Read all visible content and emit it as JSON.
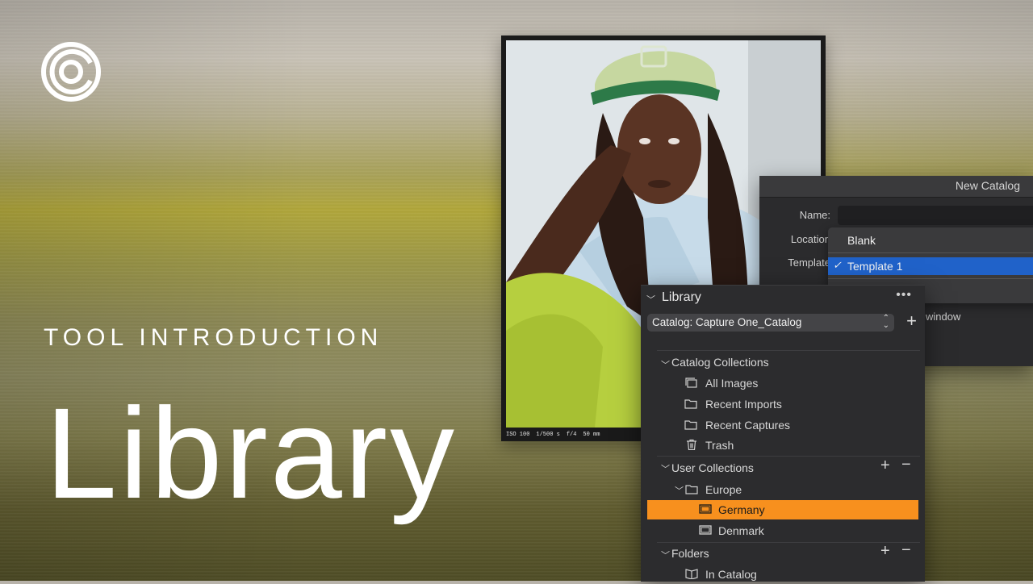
{
  "branding": {
    "tool_intro": "TOOL INTRODUCTION",
    "big_title": "Library",
    "logo_icon": "capture-one-logo-icon"
  },
  "photo": {
    "caption": {
      "iso": "ISO 100",
      "shutter": "1/500 s",
      "aperture": "f/4",
      "focal": "50 mm"
    }
  },
  "new_catalog_dialog": {
    "title": "New Catalog",
    "name_label": "Name:",
    "location_label": "Location",
    "template_label": "Template",
    "window_text": "window",
    "template_options": [
      {
        "label": "Blank",
        "selected": false
      },
      {
        "label": "Template 1",
        "selected": true
      }
    ]
  },
  "library_panel": {
    "title": "Library",
    "more_label": "•••",
    "catalog_selector": "Catalog: Capture One_Catalog",
    "catalog_collections": {
      "title": "Catalog Collections",
      "items": [
        {
          "label": "All Images",
          "icon": "all-images-icon"
        },
        {
          "label": "Recent Imports",
          "icon": "folder-icon"
        },
        {
          "label": "Recent Captures",
          "icon": "folder-icon"
        },
        {
          "label": "Trash",
          "icon": "trash-icon"
        }
      ]
    },
    "user_collections": {
      "title": "User Collections",
      "group": "Europe",
      "items": [
        {
          "label": "Germany",
          "selected": true
        },
        {
          "label": "Denmark",
          "selected": false
        }
      ]
    },
    "folders": {
      "title": "Folders",
      "items": [
        {
          "label": "In Catalog",
          "icon": "catalog-book-icon"
        }
      ]
    }
  },
  "colors": {
    "accent_orange": "#f7901e",
    "selection_blue": "#2062c9",
    "panel_bg": "#2c2c2e"
  }
}
